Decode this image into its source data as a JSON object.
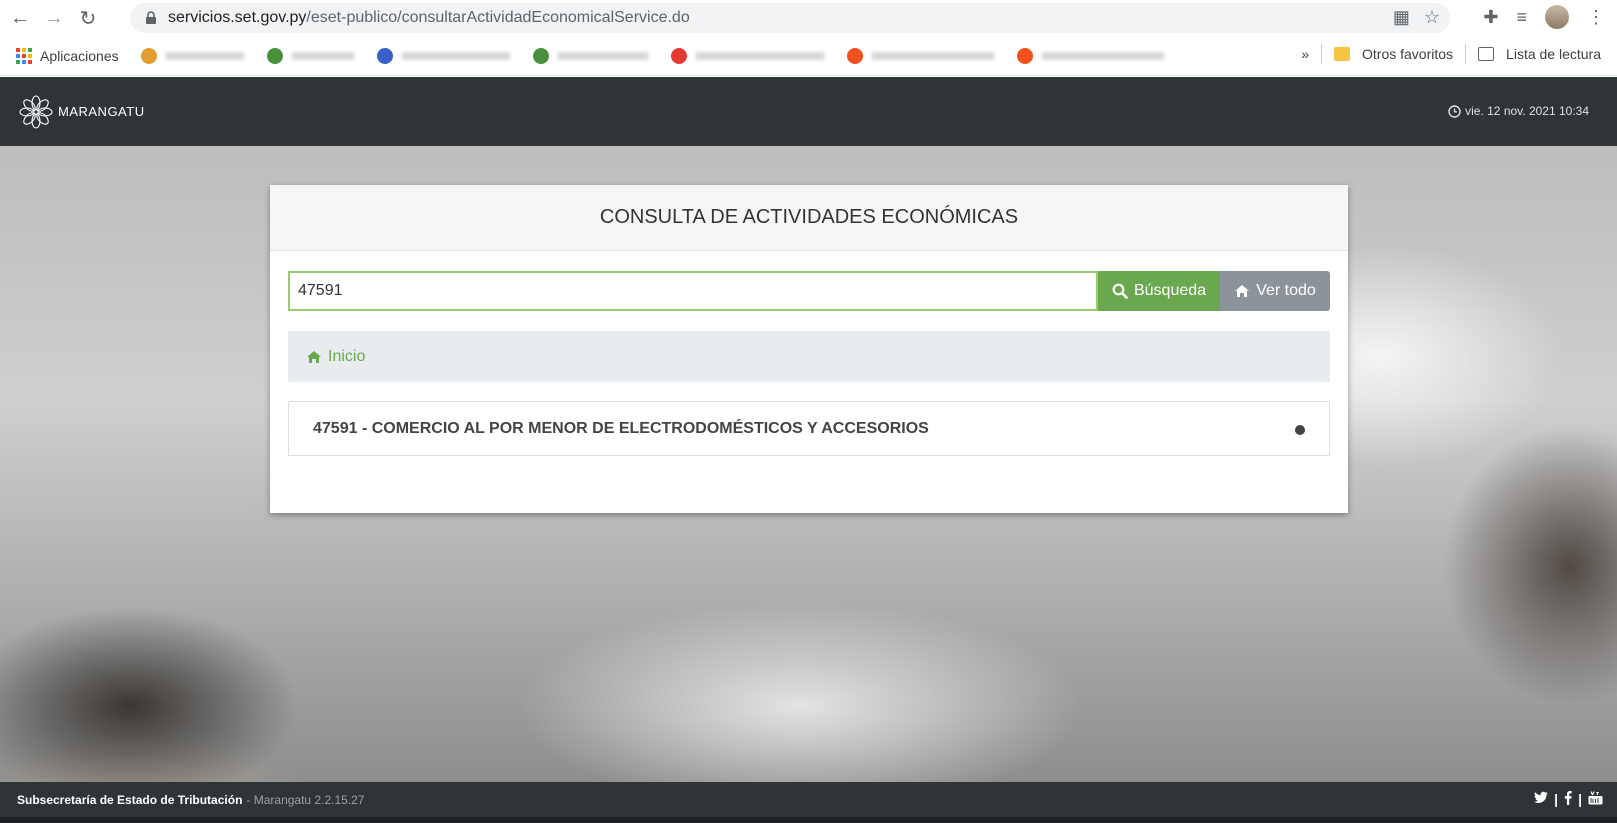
{
  "browser": {
    "url_host": "servicios.set.gov.py",
    "url_path": "/eset-publico/consultarActividadEconomicalService.do",
    "bookmarks": {
      "apps_label": "Aplicaciones",
      "more": "»",
      "other_favorites": "Otros favoritos",
      "reading_list": "Lista de lectura"
    }
  },
  "header": {
    "logo_text": "MARANGATU",
    "datetime": "vie. 12 nov. 2021 10:34"
  },
  "card": {
    "title": "CONSULTA DE ACTIVIDADES ECONÓMICAS",
    "search_value": "47591",
    "search_button": "Búsqueda",
    "view_all_button": "Ver todo",
    "breadcrumb_home": "Inicio",
    "result_text": "47591 - COMERCIO AL POR MENOR DE ELECTRODOMÉSTICOS Y ACCESORIOS"
  },
  "footer": {
    "org": "Subsecretaría de Estado de Tributación",
    "version": "- Marangatu 2.2.15.27",
    "social_sep": "|"
  },
  "colors": {
    "header_bg": "#2f3437",
    "accent_green": "#6aa84f",
    "button_gray": "#8c949a"
  }
}
